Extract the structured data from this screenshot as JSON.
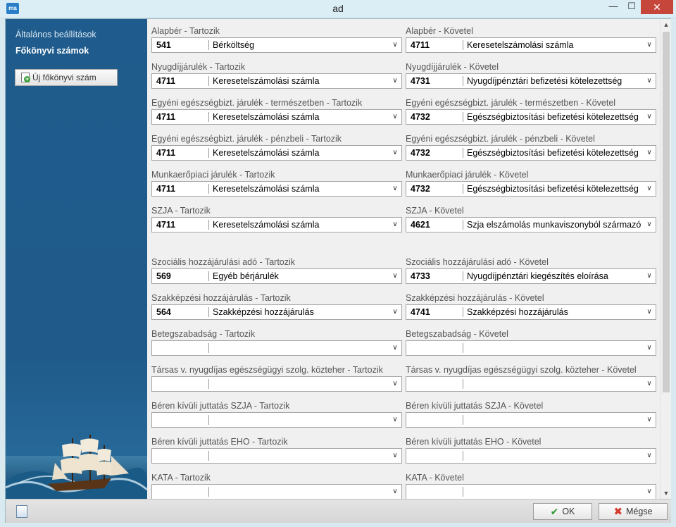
{
  "window": {
    "title": "ad",
    "app_icon_text": "ma",
    "minimize_glyph": "—",
    "maximize_glyph": "☐",
    "close_glyph": "✕"
  },
  "sidebar": {
    "general_settings": "Általános beállítások",
    "ledger_accounts": "Főkönyvi számok",
    "new_account_button": "Új főkönyvi szám"
  },
  "rows": [
    {
      "left": {
        "label": "Alapbér - Tartozik",
        "code": "541",
        "name": "Bérköltség"
      },
      "right": {
        "label": "Alapbér - Követel",
        "code": "4711",
        "name": "Keresetelszámolási számla"
      }
    },
    {
      "left": {
        "label": "Nyugdíjjárulék - Tartozik",
        "code": "4711",
        "name": "Keresetelszámolási számla"
      },
      "right": {
        "label": "Nyugdíjjárulék - Követel",
        "code": "4731",
        "name": "Nyugdíjpénztári befizetési kötelezettség"
      }
    },
    {
      "left": {
        "label": "Egyéni egészségbizt. járulék - természetben - Tartozik",
        "code": "4711",
        "name": "Keresetelszámolási számla"
      },
      "right": {
        "label": "Egyéni egészségbizt. járulék - természetben - Követel",
        "code": "4732",
        "name": "Egészségbiztosítási befizetési kötelezettség"
      }
    },
    {
      "left": {
        "label": "Egyéni egészségbizt. járulék - pénzbeli - Tartozik",
        "code": "4711",
        "name": "Keresetelszámolási számla"
      },
      "right": {
        "label": "Egyéni egészségbizt. járulék - pénzbeli - Követel",
        "code": "4732",
        "name": "Egészségbiztosítási befizetési kötelezettség"
      }
    },
    {
      "left": {
        "label": "Munkaerőpiaci járulék - Tartozik",
        "code": "4711",
        "name": "Keresetelszámolási számla"
      },
      "right": {
        "label": "Munkaerőpiaci járulék - Követel",
        "code": "4732",
        "name": "Egészségbiztosítási befizetési kötelezettség"
      }
    },
    {
      "left": {
        "label": "SZJA - Tartozik",
        "code": "4711",
        "name": "Keresetelszámolási számla"
      },
      "right": {
        "label": "SZJA - Követel",
        "code": "4621",
        "name": "Szja elszámolás munkaviszonyból származó jövedelem"
      }
    },
    {
      "left": {
        "label": "Szociális hozzájárulási adó - Tartozik",
        "code": "569",
        "name": "Egyéb bérjárulék"
      },
      "right": {
        "label": "Szociális hozzájárulási adó - Követel",
        "code": "4733",
        "name": "Nyugdíjpénztári kiegészítés eloírása"
      }
    },
    {
      "left": {
        "label": "Szakképzési hozzájárulás - Tartozik",
        "code": "564",
        "name": "Szakképzési hozzájárulás"
      },
      "right": {
        "label": "Szakképzési hozzájárulás - Követel",
        "code": "4741",
        "name": "Szakképzési hozzájárulás"
      }
    },
    {
      "left": {
        "label": "Betegszabadság - Tartozik",
        "code": "",
        "name": ""
      },
      "right": {
        "label": "Betegszabadság - Követel",
        "code": "",
        "name": ""
      }
    },
    {
      "left": {
        "label": "Társas v. nyugdíjas egészségügyi szolg. közteher - Tartozik",
        "code": "",
        "name": ""
      },
      "right": {
        "label": "Társas v. nyugdíjas egészségügyi szolg. közteher - Követel",
        "code": "",
        "name": ""
      }
    },
    {
      "left": {
        "label": "Béren kívüli juttatás SZJA - Tartozik",
        "code": "",
        "name": ""
      },
      "right": {
        "label": "Béren kívüli juttatás SZJA - Követel",
        "code": "",
        "name": ""
      }
    },
    {
      "left": {
        "label": "Béren kívüli juttatás EHO - Tartozik",
        "code": "",
        "name": ""
      },
      "right": {
        "label": "Béren kívüli juttatás EHO - Követel",
        "code": "",
        "name": ""
      }
    },
    {
      "left": {
        "label": "KATA - Tartozik",
        "code": "",
        "name": ""
      },
      "right": {
        "label": "KATA - Követel",
        "code": "",
        "name": ""
      }
    }
  ],
  "footer": {
    "ok_label": "OK",
    "cancel_label": "Mégse"
  },
  "colors": {
    "sidebar_bg": "#1f5c8d",
    "content_bg": "#f0f0f0",
    "close_button": "#c7463b"
  }
}
